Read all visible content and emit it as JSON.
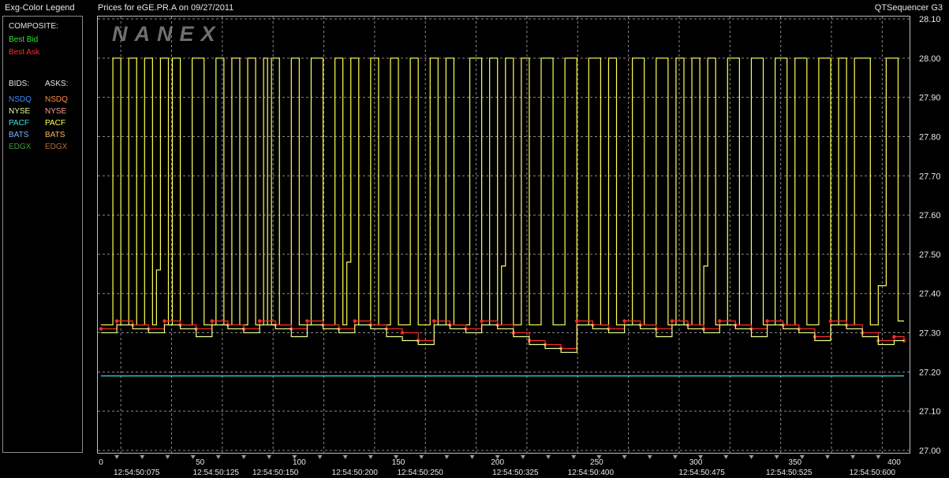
{
  "header": {
    "legend_title": "Exg-Color Legend",
    "chart_title": "Prices for  eGE.PR.A  on  09/27/2011",
    "app_name": "QTSequencer G3"
  },
  "watermark": "NANEX",
  "legend": {
    "composite_heading": "COMPOSITE:",
    "best_bid": {
      "label": "Best Bid",
      "color": "#2ee82e"
    },
    "best_ask": {
      "label": "Best Ask",
      "color": "#ff2b2b"
    },
    "bids_heading": "BIDS:",
    "asks_heading": "ASKS:",
    "bids": [
      {
        "label": "NSDQ",
        "color": "#3a8cff"
      },
      {
        "label": "NYSE",
        "color": "#e8ff8a"
      },
      {
        "label": "PACF",
        "color": "#33e6e6"
      },
      {
        "label": "BATS",
        "color": "#7ab4ff"
      },
      {
        "label": "EDGX",
        "color": "#3c9a3c"
      }
    ],
    "asks": [
      {
        "label": "NSDQ",
        "color": "#ff8a3a"
      },
      {
        "label": "NYSE",
        "color": "#ff9a9a"
      },
      {
        "label": "PACF",
        "color": "#ffff55"
      },
      {
        "label": "BATS",
        "color": "#ffb45a"
      },
      {
        "label": "EDGX",
        "color": "#b0703a"
      }
    ]
  },
  "chart_data": {
    "type": "line",
    "title": "Prices for  eGE.PR.A  on  09/27/2011",
    "xlabel": "",
    "ylabel": "",
    "xlim": [
      0,
      405
    ],
    "ylim": [
      27.0,
      28.1
    ],
    "grid": true,
    "y_ticks": [
      "27.00",
      "27.10",
      "27.20",
      "27.30",
      "27.40",
      "27.50",
      "27.60",
      "27.70",
      "27.80",
      "27.90",
      "28.00",
      "28.10"
    ],
    "x_ticks": [
      0,
      50,
      100,
      150,
      200,
      250,
      300,
      350,
      400
    ],
    "time_labels": [
      {
        "x": 18,
        "label": "12:54:50:075"
      },
      {
        "x": 58,
        "label": "12:54:50:125"
      },
      {
        "x": 88,
        "label": "12:54:50:150"
      },
      {
        "x": 128,
        "label": "12:54:50:200"
      },
      {
        "x": 161,
        "label": "12:54:50:250"
      },
      {
        "x": 209,
        "label": "12:54:50:325"
      },
      {
        "x": 247,
        "label": "12:54:50:400"
      },
      {
        "x": 303,
        "label": "12:54:50:475"
      },
      {
        "x": 347,
        "label": "12:54:50:525"
      },
      {
        "x": 389,
        "label": "12:54:50:600"
      }
    ],
    "series": [
      {
        "name": "PACF",
        "color": "#ffff55",
        "note": "oscillating ask quote",
        "x": [
          0,
          6,
          10,
          14,
          18,
          22,
          26,
          28,
          30,
          34,
          36,
          40,
          46,
          52,
          58,
          62,
          66,
          70,
          74,
          78,
          82,
          84,
          86,
          90,
          96,
          100,
          106,
          112,
          118,
          122,
          124,
          126,
          130,
          136,
          140,
          146,
          150,
          156,
          160,
          166,
          170,
          174,
          178,
          186,
          192,
          196,
          200,
          202,
          204,
          208,
          212,
          216,
          222,
          228,
          234,
          240,
          246,
          252,
          256,
          260,
          268,
          274,
          280,
          286,
          290,
          294,
          298,
          302,
          304,
          306,
          310,
          316,
          322,
          328,
          334,
          340,
          346,
          350,
          356,
          362,
          368,
          372,
          376,
          380,
          388,
          392,
          396,
          402,
          405
        ],
        "y": [
          27.32,
          28.0,
          27.32,
          28.0,
          27.32,
          28.0,
          27.32,
          27.46,
          28.0,
          27.32,
          28.0,
          27.32,
          28.0,
          27.32,
          28.0,
          27.32,
          28.0,
          27.32,
          28.0,
          27.32,
          28.0,
          27.32,
          28.0,
          27.32,
          28.0,
          27.32,
          28.0,
          27.32,
          28.0,
          27.32,
          27.48,
          28.0,
          27.32,
          28.0,
          27.32,
          28.0,
          27.32,
          28.0,
          27.32,
          28.0,
          27.32,
          28.0,
          27.32,
          28.0,
          27.32,
          28.0,
          27.32,
          27.47,
          28.0,
          27.32,
          28.0,
          27.32,
          28.0,
          27.32,
          28.0,
          27.32,
          28.0,
          27.32,
          28.0,
          27.32,
          28.0,
          27.32,
          28.0,
          27.32,
          28.0,
          27.32,
          28.0,
          27.32,
          27.47,
          28.0,
          27.32,
          28.0,
          27.32,
          28.0,
          27.32,
          28.0,
          27.32,
          28.0,
          27.32,
          28.0,
          27.32,
          28.0,
          27.32,
          28.0,
          27.32,
          27.42,
          28.0,
          27.33,
          27.33
        ]
      },
      {
        "name": "Best Ask",
        "color": "#ff2b2b",
        "x": [
          0,
          8,
          16,
          24,
          32,
          40,
          48,
          56,
          64,
          72,
          80,
          88,
          96,
          104,
          112,
          120,
          128,
          136,
          144,
          152,
          160,
          168,
          176,
          184,
          192,
          200,
          208,
          216,
          224,
          232,
          240,
          248,
          256,
          264,
          272,
          280,
          288,
          296,
          304,
          312,
          320,
          328,
          336,
          344,
          352,
          360,
          368,
          376,
          384,
          392,
          400,
          405
        ],
        "y": [
          27.31,
          27.33,
          27.32,
          27.31,
          27.33,
          27.32,
          27.31,
          27.33,
          27.32,
          27.31,
          27.33,
          27.32,
          27.31,
          27.33,
          27.32,
          27.31,
          27.33,
          27.32,
          27.31,
          27.3,
          27.28,
          27.33,
          27.32,
          27.31,
          27.33,
          27.32,
          27.3,
          27.28,
          27.27,
          27.26,
          27.33,
          27.32,
          27.31,
          27.33,
          27.32,
          27.31,
          27.33,
          27.32,
          27.31,
          27.33,
          27.32,
          27.31,
          27.33,
          27.32,
          27.31,
          27.29,
          27.33,
          27.32,
          27.3,
          27.28,
          27.29,
          27.28
        ]
      },
      {
        "name": "NYSE",
        "color": "#e8ff8a",
        "note": "bid quote",
        "x": [
          0,
          8,
          16,
          24,
          32,
          40,
          48,
          56,
          64,
          72,
          80,
          88,
          96,
          104,
          112,
          120,
          128,
          136,
          144,
          152,
          160,
          168,
          176,
          184,
          192,
          200,
          208,
          216,
          224,
          232,
          240,
          248,
          256,
          264,
          272,
          280,
          288,
          296,
          304,
          312,
          320,
          328,
          336,
          344,
          352,
          360,
          368,
          376,
          384,
          392,
          400,
          405
        ],
        "y": [
          27.3,
          27.32,
          27.31,
          27.3,
          27.32,
          27.31,
          27.29,
          27.32,
          27.31,
          27.3,
          27.32,
          27.31,
          27.29,
          27.32,
          27.31,
          27.3,
          27.32,
          27.31,
          27.29,
          27.28,
          27.27,
          27.32,
          27.31,
          27.3,
          27.32,
          27.31,
          27.29,
          27.27,
          27.26,
          27.25,
          27.32,
          27.31,
          27.3,
          27.32,
          27.31,
          27.29,
          27.32,
          27.31,
          27.3,
          27.32,
          27.31,
          27.29,
          27.32,
          27.31,
          27.3,
          27.28,
          27.32,
          27.31,
          27.29,
          27.27,
          27.28,
          27.28
        ]
      },
      {
        "name": "PACF bid",
        "color": "#33e6e6",
        "x": [
          0,
          405
        ],
        "y": [
          27.19,
          27.19
        ]
      }
    ]
  }
}
